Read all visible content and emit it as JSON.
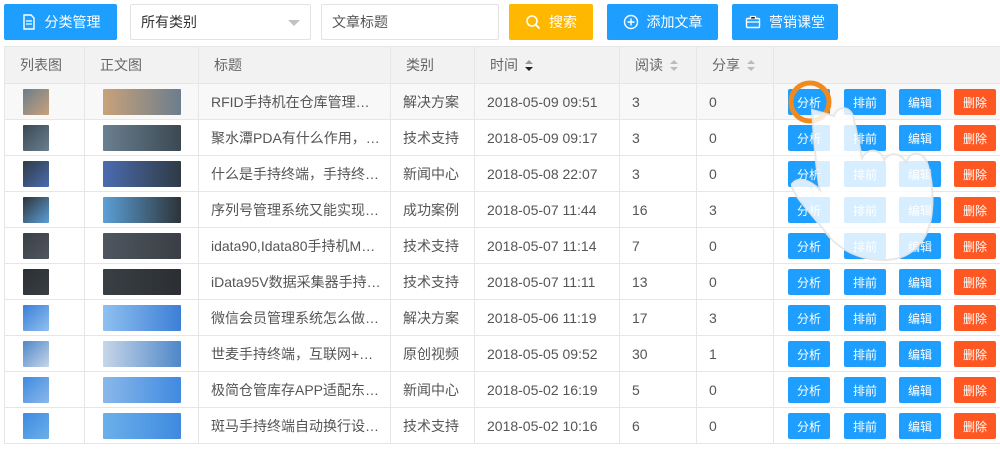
{
  "toolbar": {
    "category_btn": "分类管理",
    "select_value": "所有类别",
    "title_placeholder": "文章标题",
    "search_btn": "搜索",
    "add_btn": "添加文章",
    "marketing_btn": "营销课堂"
  },
  "table": {
    "headers": [
      "列表图",
      "正文图",
      "标题",
      "类别",
      "时间",
      "阅读",
      "分享",
      ""
    ],
    "actions": {
      "analyze": "分析",
      "rank": "排前",
      "edit": "编辑",
      "delete": "删除"
    },
    "rows": [
      {
        "title": "RFID手持机在仓库管理…",
        "category": "解决方案",
        "time": "2018-05-09 09:51",
        "reads": "3",
        "shares": "0"
      },
      {
        "title": "聚水潭PDA有什么作用，…",
        "category": "技术支持",
        "time": "2018-05-09 09:17",
        "reads": "3",
        "shares": "0"
      },
      {
        "title": "什么是手持终端，手持终…",
        "category": "新闻中心",
        "time": "2018-05-08 22:07",
        "reads": "3",
        "shares": "0"
      },
      {
        "title": "序列号管理系统又能实现…",
        "category": "成功案例",
        "time": "2018-05-07 11:44",
        "reads": "16",
        "shares": "3"
      },
      {
        "title": "idata90,Idata80手持机M…",
        "category": "技术支持",
        "time": "2018-05-07 11:14",
        "reads": "7",
        "shares": "0"
      },
      {
        "title": "iData95V数据采集器手持…",
        "category": "技术支持",
        "time": "2018-05-07 11:11",
        "reads": "13",
        "shares": "0"
      },
      {
        "title": "微信会员管理系统怎么做…",
        "category": "解决方案",
        "time": "2018-05-06 11:19",
        "reads": "17",
        "shares": "3"
      },
      {
        "title": "世麦手持终端，互联网+…",
        "category": "原创视频",
        "time": "2018-05-05 09:52",
        "reads": "30",
        "shares": "1"
      },
      {
        "title": "极简仓管库存APP适配东…",
        "category": "新闻中心",
        "time": "2018-05-02 16:19",
        "reads": "5",
        "shares": "0"
      },
      {
        "title": "斑马手持终端自动换行设…",
        "category": "技术支持",
        "time": "2018-05-02 10:16",
        "reads": "6",
        "shares": "0"
      }
    ]
  },
  "colors": {
    "primary": "#1e9fff",
    "warning": "#ffb800",
    "danger": "#ff5722",
    "header_bg": "#f2f2f2"
  }
}
